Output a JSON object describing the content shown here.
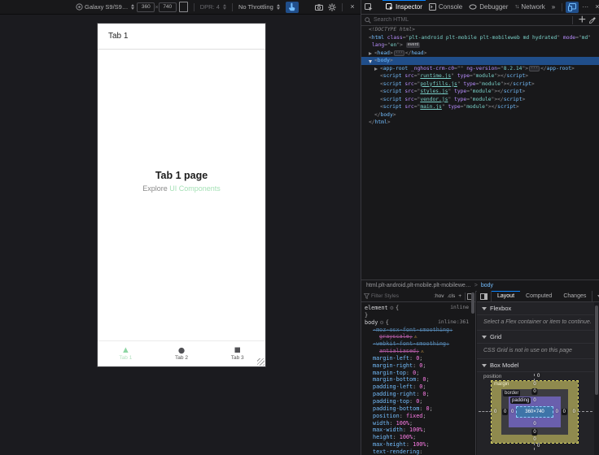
{
  "rdm": {
    "device_label": "Galaxy S9/S9…",
    "viewport_width": "360",
    "times_symbol": "×",
    "viewport_height": "740",
    "dpr_label": "DPR: 4",
    "throttling_label": "No Throttling"
  },
  "device": {
    "header_title": "Tab 1",
    "page_title": "Tab 1 page",
    "subtitle_text": "Explore",
    "subtitle_link": "UI Components",
    "tabs": [
      {
        "label": "Tab 1",
        "shape": "▲",
        "active": true
      },
      {
        "label": "Tab 2",
        "shape": "●",
        "active": false
      },
      {
        "label": "Tab 3",
        "shape": "■",
        "active": false
      }
    ],
    "accent_green": "#8ed6a4"
  },
  "devtools": {
    "toolbar_tabs": [
      {
        "label": "Inspector",
        "active": true
      },
      {
        "label": "Console",
        "active": false
      },
      {
        "label": "Debugger",
        "active": false
      },
      {
        "label": "Network",
        "active": false
      }
    ],
    "more_tabs_glyph": "»",
    "menu_glyph": "···",
    "close_glyph": "×",
    "search_placeholder": "Search HTML",
    "add_node_glyph": "+",
    "markup_lines": [
      {
        "pad": 9,
        "segments": [
          {
            "t": "<!DOCTYPE html>",
            "c": "doc"
          }
        ]
      },
      {
        "pad": 9,
        "segments": [
          {
            "t": "<",
            "c": "pn"
          },
          {
            "t": "html",
            "c": "tag"
          },
          {
            "t": " ",
            "c": "pn"
          },
          {
            "t": "class",
            "c": "attr"
          },
          {
            "t": "=\"",
            "c": "pn"
          },
          {
            "t": "plt-android plt-mobile plt-mobileweb md hydrated",
            "c": "val"
          },
          {
            "t": "\" ",
            "c": "pn"
          },
          {
            "t": "mode",
            "c": "attr"
          },
          {
            "t": "=\"",
            "c": "pn"
          },
          {
            "t": "md",
            "c": "val"
          },
          {
            "t": "\"",
            "c": "pn"
          }
        ]
      },
      {
        "pad": 13,
        "segments": [
          {
            "t": "lang",
            "c": "attr"
          },
          {
            "t": "=\"",
            "c": "pn"
          },
          {
            "t": "en",
            "c": "val"
          },
          {
            "t": "\"> ",
            "c": "pn"
          },
          {
            "t": "event",
            "c": "badge"
          }
        ]
      },
      {
        "pad": 16,
        "twisty": "closed",
        "segments": [
          {
            "t": "<",
            "c": "pn"
          },
          {
            "t": "head",
            "c": "tag"
          },
          {
            "t": ">",
            "c": "pn"
          },
          {
            "t": "···",
            "c": "ell"
          },
          {
            "t": "</",
            "c": "pn"
          },
          {
            "t": "head",
            "c": "tag"
          },
          {
            "t": ">",
            "c": "pn"
          }
        ]
      },
      {
        "pad": 16,
        "twisty": "open",
        "selected": true,
        "segments": [
          {
            "t": "<",
            "c": "pn"
          },
          {
            "t": "body",
            "c": "tag"
          },
          {
            "t": ">",
            "c": "pn"
          }
        ]
      },
      {
        "pad": 23,
        "twisty": "closed",
        "segments": [
          {
            "t": "<",
            "c": "pn"
          },
          {
            "t": "app-root",
            "c": "tag"
          },
          {
            "t": " ",
            "c": "pn"
          },
          {
            "t": "_nghost-crm-c0",
            "c": "attr"
          },
          {
            "t": "=\"\" ",
            "c": "pn"
          },
          {
            "t": "ng-version",
            "c": "attr"
          },
          {
            "t": "=\"",
            "c": "pn"
          },
          {
            "t": "8.2.14",
            "c": "val"
          },
          {
            "t": "\">",
            "c": "pn"
          },
          {
            "t": "···",
            "c": "ell"
          },
          {
            "t": "</",
            "c": "pn"
          },
          {
            "t": "app-root",
            "c": "tag"
          },
          {
            "t": ">",
            "c": "pn"
          }
        ]
      },
      {
        "pad": 23,
        "segments": [
          {
            "t": "<",
            "c": "pn"
          },
          {
            "t": "script",
            "c": "tag"
          },
          {
            "t": " ",
            "c": "pn"
          },
          {
            "t": "src",
            "c": "attr"
          },
          {
            "t": "=\"",
            "c": "pn"
          },
          {
            "t": "runtime.js",
            "c": "lnk"
          },
          {
            "t": "\" ",
            "c": "pn"
          },
          {
            "t": "type",
            "c": "attr"
          },
          {
            "t": "=\"",
            "c": "pn"
          },
          {
            "t": "module",
            "c": "val"
          },
          {
            "t": "\">",
            "c": "pn"
          },
          {
            "t": "</",
            "c": "pn"
          },
          {
            "t": "script",
            "c": "tag"
          },
          {
            "t": ">",
            "c": "pn"
          }
        ]
      },
      {
        "pad": 23,
        "segments": [
          {
            "t": "<",
            "c": "pn"
          },
          {
            "t": "script",
            "c": "tag"
          },
          {
            "t": " ",
            "c": "pn"
          },
          {
            "t": "src",
            "c": "attr"
          },
          {
            "t": "=\"",
            "c": "pn"
          },
          {
            "t": "polyfills.js",
            "c": "lnk"
          },
          {
            "t": "\" ",
            "c": "pn"
          },
          {
            "t": "type",
            "c": "attr"
          },
          {
            "t": "=\"",
            "c": "pn"
          },
          {
            "t": "module",
            "c": "val"
          },
          {
            "t": "\">",
            "c": "pn"
          },
          {
            "t": "</",
            "c": "pn"
          },
          {
            "t": "script",
            "c": "tag"
          },
          {
            "t": ">",
            "c": "pn"
          }
        ]
      },
      {
        "pad": 23,
        "segments": [
          {
            "t": "<",
            "c": "pn"
          },
          {
            "t": "script",
            "c": "tag"
          },
          {
            "t": " ",
            "c": "pn"
          },
          {
            "t": "src",
            "c": "attr"
          },
          {
            "t": "=\"",
            "c": "pn"
          },
          {
            "t": "styles.js",
            "c": "lnk"
          },
          {
            "t": "\" ",
            "c": "pn"
          },
          {
            "t": "type",
            "c": "attr"
          },
          {
            "t": "=\"",
            "c": "pn"
          },
          {
            "t": "module",
            "c": "val"
          },
          {
            "t": "\">",
            "c": "pn"
          },
          {
            "t": "</",
            "c": "pn"
          },
          {
            "t": "script",
            "c": "tag"
          },
          {
            "t": ">",
            "c": "pn"
          }
        ]
      },
      {
        "pad": 23,
        "segments": [
          {
            "t": "<",
            "c": "pn"
          },
          {
            "t": "script",
            "c": "tag"
          },
          {
            "t": " ",
            "c": "pn"
          },
          {
            "t": "src",
            "c": "attr"
          },
          {
            "t": "=\"",
            "c": "pn"
          },
          {
            "t": "vendor.js",
            "c": "lnk"
          },
          {
            "t": "\" ",
            "c": "pn"
          },
          {
            "t": "type",
            "c": "attr"
          },
          {
            "t": "=\"",
            "c": "pn"
          },
          {
            "t": "module",
            "c": "val"
          },
          {
            "t": "\">",
            "c": "pn"
          },
          {
            "t": "</",
            "c": "pn"
          },
          {
            "t": "script",
            "c": "tag"
          },
          {
            "t": ">",
            "c": "pn"
          }
        ]
      },
      {
        "pad": 23,
        "segments": [
          {
            "t": "<",
            "c": "pn"
          },
          {
            "t": "script",
            "c": "tag"
          },
          {
            "t": " ",
            "c": "pn"
          },
          {
            "t": "src",
            "c": "attr"
          },
          {
            "t": "=\"",
            "c": "pn"
          },
          {
            "t": "main.js",
            "c": "lnk"
          },
          {
            "t": "\" ",
            "c": "pn"
          },
          {
            "t": "type",
            "c": "attr"
          },
          {
            "t": "=\"",
            "c": "pn"
          },
          {
            "t": "module",
            "c": "val"
          },
          {
            "t": "\">",
            "c": "pn"
          },
          {
            "t": "</",
            "c": "pn"
          },
          {
            "t": "script",
            "c": "tag"
          },
          {
            "t": ">",
            "c": "pn"
          }
        ]
      },
      {
        "pad": 16,
        "segments": [
          {
            "t": "</",
            "c": "pn"
          },
          {
            "t": "body",
            "c": "tag"
          },
          {
            "t": ">",
            "c": "pn"
          }
        ]
      },
      {
        "pad": 9,
        "segments": [
          {
            "t": "</",
            "c": "pn"
          },
          {
            "t": "html",
            "c": "tag"
          },
          {
            "t": ">",
            "c": "pn"
          }
        ]
      }
    ],
    "breadcrumb": {
      "parent": "html.plt-android.plt-mobile.plt-mobilewe…",
      "separator": ">",
      "current": "body"
    },
    "rules": {
      "filter_placeholder": "Filter Styles",
      "pseudo_toggle": ":hov",
      "class_toggle": ".cls",
      "add_rule_glyph": "+",
      "rows": [
        {
          "type": "open",
          "selector": "element",
          "source": "inline"
        },
        {
          "type": "close"
        },
        {
          "type": "open",
          "selector": "body",
          "source": "inline:361"
        },
        {
          "type": "wrapdecl",
          "prop": "-moz-osx-font-smoothing:",
          "value": "grayscale;",
          "strike": true,
          "warn": true
        },
        {
          "type": "wrapdecl",
          "prop": "-webkit-font-smoothing:",
          "value": "antialiased;",
          "strike": true,
          "warn": true
        },
        {
          "type": "decl",
          "prop": "margin-left",
          "value": "0"
        },
        {
          "type": "decl",
          "prop": "margin-right",
          "value": "0"
        },
        {
          "type": "decl",
          "prop": "margin-top",
          "value": "0"
        },
        {
          "type": "decl",
          "prop": "margin-bottom",
          "value": "0"
        },
        {
          "type": "decl",
          "prop": "padding-left",
          "value": "0"
        },
        {
          "type": "decl",
          "prop": "padding-right",
          "value": "0"
        },
        {
          "type": "decl",
          "prop": "padding-top",
          "value": "0"
        },
        {
          "type": "decl",
          "prop": "padding-bottom",
          "value": "0"
        },
        {
          "type": "decl",
          "prop": "position",
          "value": "fixed"
        },
        {
          "type": "decl",
          "prop": "width",
          "value": "100%"
        },
        {
          "type": "decl",
          "prop": "max-width",
          "value": "100%"
        },
        {
          "type": "decl",
          "prop": "height",
          "value": "100%"
        },
        {
          "type": "decl",
          "prop": "max-height",
          "value": "100%"
        },
        {
          "type": "declopen",
          "prop": "text-rendering"
        }
      ]
    },
    "sidebar_tabs": [
      {
        "label": "Layout",
        "active": true
      },
      {
        "label": "Computed",
        "active": false
      },
      {
        "label": "Changes",
        "active": false
      }
    ],
    "layout": {
      "flexbox_header": "Flexbox",
      "flexbox_message": "Select a Flex container or item to continue.",
      "grid_header": "Grid",
      "grid_message": "CSS Grid is not in use on this page",
      "boxmodel_header": "Box Model",
      "box_model": {
        "position_label": "position",
        "position_top": "0",
        "position_bottom": "0",
        "margin_label": "margin",
        "border_label": "border",
        "padding_label": "padding",
        "margin": {
          "top": "0",
          "right": "0",
          "bottom": "0",
          "left": "0"
        },
        "border": {
          "top": "0",
          "right": "0",
          "bottom": "0",
          "left": "0"
        },
        "padding": {
          "top": "0",
          "right": "0",
          "bottom": "0",
          "left": "0"
        },
        "content": "360×740"
      }
    },
    "colors": {
      "accent_blue": "#75bfff",
      "selection_blue": "#204e8a",
      "value_pink": "#ff7de9",
      "warning_yellow": "#ffbd4f"
    }
  }
}
